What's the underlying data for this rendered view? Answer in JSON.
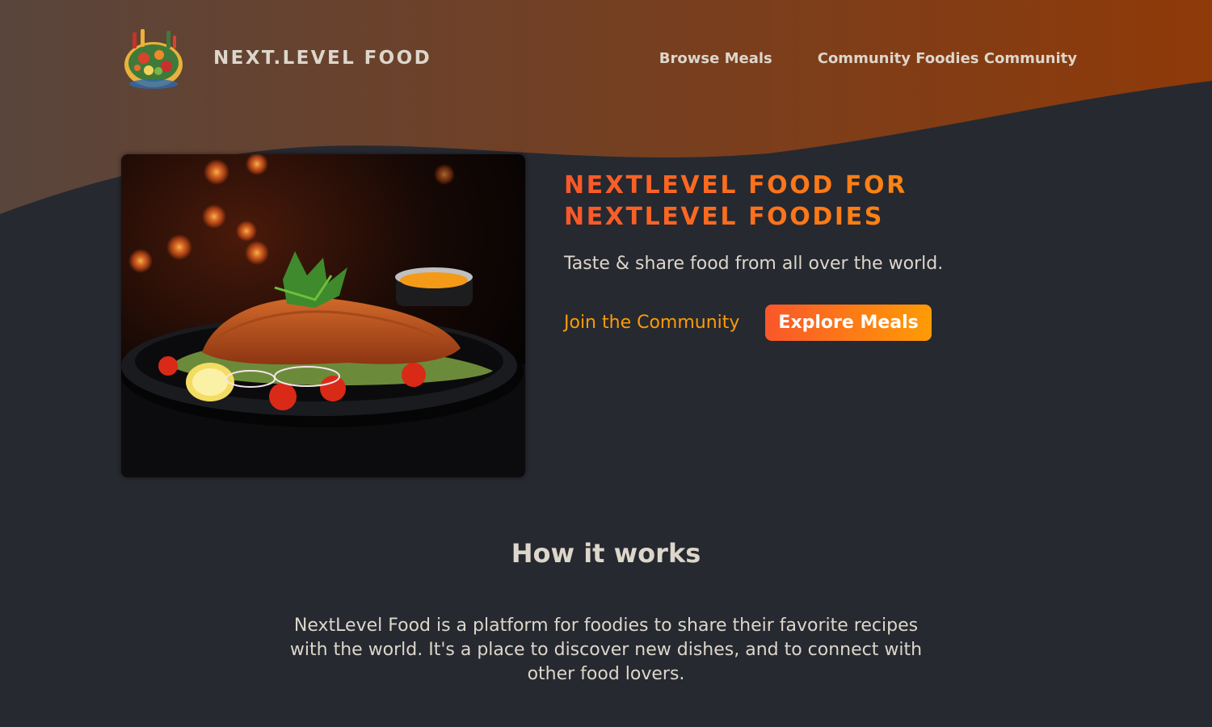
{
  "header": {
    "logo_text": "NEXT.LEVEL FOOD",
    "nav": [
      {
        "label": "Browse Meals"
      },
      {
        "label": "Community Foodies Community"
      }
    ]
  },
  "hero": {
    "title": "NextLevel Food for NextLevel Foodies",
    "subtitle": "Taste & share food from all over the world.",
    "join_label": "Join the Community",
    "explore_label": "Explore Meals"
  },
  "how_it_works": {
    "heading": "How it works",
    "body": "NextLevel Food is a platform for foodies to share their favorite recipes with the world. It's a place to discover new dishes, and to connect with other food lovers."
  },
  "colors": {
    "background": "#262930",
    "text": "#ddd6cb",
    "accent_start": "#f9572a",
    "accent_end": "#ff9b05",
    "header_wave_start": "#59453c",
    "header_wave_end": "#8f3a09"
  },
  "icons": {
    "logo": "food-plate-logo-icon",
    "hero_image": "schnitzel-plate-image"
  }
}
